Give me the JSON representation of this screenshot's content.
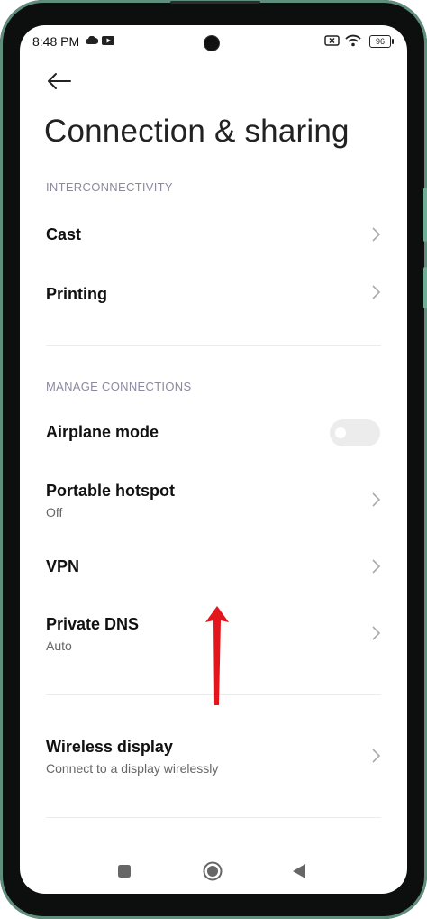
{
  "status": {
    "time": "8:48 PM",
    "battery": "96",
    "icons": [
      "cloud-icon",
      "youtube-icon",
      "close-box-icon",
      "wifi-icon",
      "battery-icon"
    ]
  },
  "header": {
    "back_icon": "arrow-left-icon",
    "title": "Connection & sharing"
  },
  "sections": [
    {
      "header": "INTERCONNECTIVITY",
      "items": [
        {
          "title": "Cast"
        },
        {
          "title": "Printing"
        }
      ]
    },
    {
      "header": "MANAGE CONNECTIONS",
      "items": [
        {
          "title": "Airplane mode",
          "toggle": "off"
        },
        {
          "title": "Portable hotspot",
          "subtitle": "Off"
        },
        {
          "title": "VPN"
        },
        {
          "title": "Private DNS",
          "subtitle": "Auto"
        }
      ]
    },
    {
      "items": [
        {
          "title": "Wireless display",
          "subtitle": "Connect to a display wirelessly"
        }
      ]
    }
  ],
  "navbar": {
    "icons": [
      "recents-square-icon",
      "home-circle-icon",
      "back-triangle-icon"
    ]
  },
  "annotation": {
    "icon": "red-up-arrow-icon",
    "color": "#e2161c"
  },
  "colors": {
    "frame_accent": "#6fae95",
    "section_header": "#8a8aa0"
  }
}
